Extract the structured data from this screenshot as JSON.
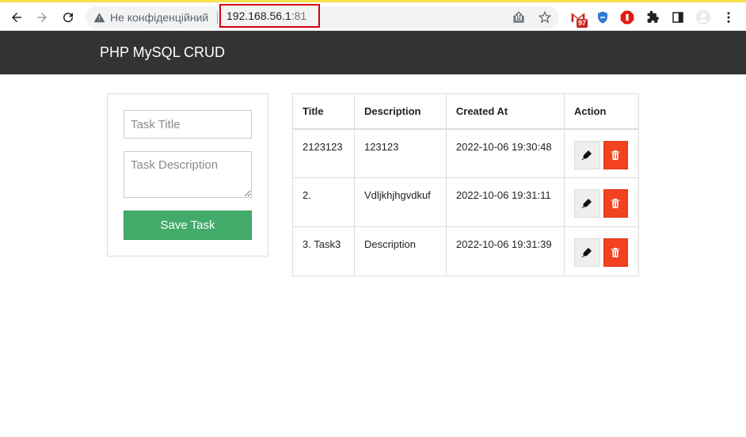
{
  "browser": {
    "security_label": "Не конфіденційний",
    "url_host": "192.168.56.1",
    "url_port": ":81",
    "gmail_badge": "97"
  },
  "header": {
    "brand": "PHP MySQL CRUD"
  },
  "form": {
    "title_placeholder": "Task Title",
    "desc_placeholder": "Task Description",
    "save_label": "Save Task"
  },
  "table": {
    "headers": [
      "Title",
      "Description",
      "Created At",
      "Action"
    ],
    "rows": [
      {
        "title": "2123123",
        "description": "123123",
        "created_at": "2022-10-06 19:30:48"
      },
      {
        "title": "2.",
        "description": "Vdljkhjhgvdkuf",
        "created_at": "2022-10-06 19:31:11"
      },
      {
        "title": "3. Task3",
        "description": "Description",
        "created_at": "2022-10-06 19:31:39"
      }
    ]
  },
  "colors": {
    "header_bg": "#333333",
    "save_button": "#42ab6a",
    "delete_button": "#f2421f",
    "edit_button": "#eeeeee",
    "url_highlight": "#d9000f"
  }
}
